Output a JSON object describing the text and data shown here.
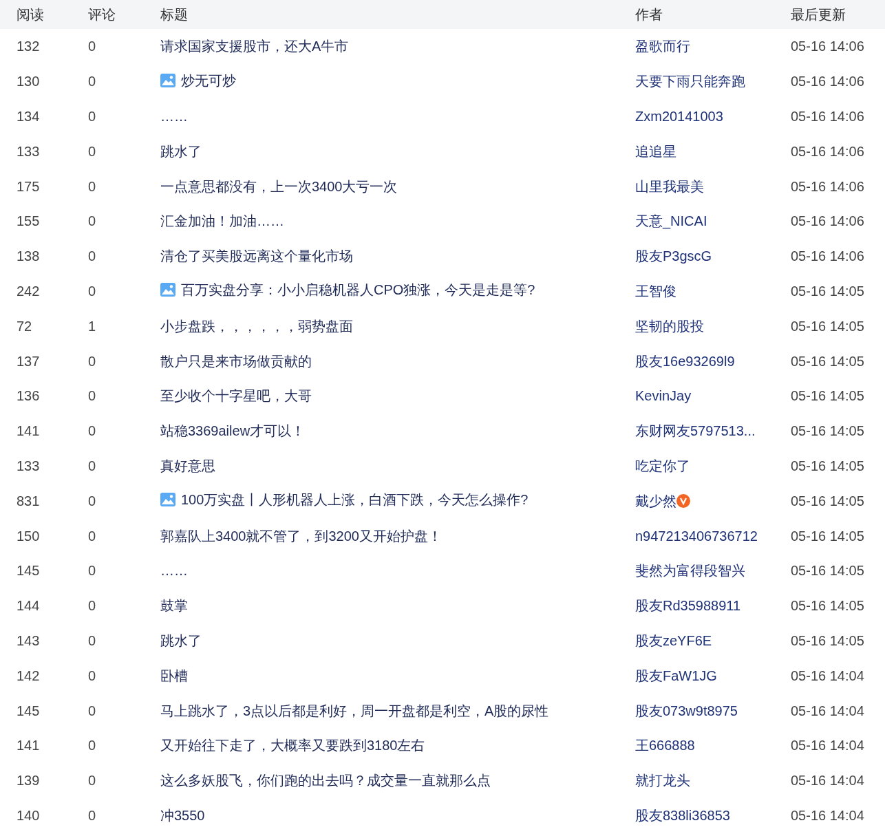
{
  "table": {
    "columns": [
      "阅读",
      "评论",
      "标题",
      "作者",
      "最后更新"
    ],
    "rows": [
      {
        "reads": "132",
        "comments": "0",
        "title": "请求国家支援股市，还大A牛市",
        "has_image": false,
        "author": "盈歌而行",
        "verified": false,
        "updated": "05-16 14:06"
      },
      {
        "reads": "130",
        "comments": "0",
        "title": "炒无可炒",
        "has_image": true,
        "author": "天要下雨只能奔跑",
        "verified": false,
        "updated": "05-16 14:06"
      },
      {
        "reads": "134",
        "comments": "0",
        "title": "……",
        "has_image": false,
        "author": "Zxm20141003",
        "verified": false,
        "updated": "05-16 14:06"
      },
      {
        "reads": "133",
        "comments": "0",
        "title": "跳水了",
        "has_image": false,
        "author": "追追星",
        "verified": false,
        "updated": "05-16 14:06"
      },
      {
        "reads": "175",
        "comments": "0",
        "title": "一点意思都没有，上一次3400大亏一次",
        "has_image": false,
        "author": "山里我最美",
        "verified": false,
        "updated": "05-16 14:06"
      },
      {
        "reads": "155",
        "comments": "0",
        "title": "汇金加油！加油……",
        "has_image": false,
        "author": "天意_NICAI",
        "verified": false,
        "updated": "05-16 14:06"
      },
      {
        "reads": "138",
        "comments": "0",
        "title": "清仓了买美股远离这个量化市场",
        "has_image": false,
        "author": "股友P3gscG",
        "verified": false,
        "updated": "05-16 14:06"
      },
      {
        "reads": "242",
        "comments": "0",
        "title": "百万实盘分享：小小启稳机器人CPO独涨，今天是走是等?",
        "has_image": true,
        "author": "王智俊",
        "verified": false,
        "updated": "05-16 14:05"
      },
      {
        "reads": "72",
        "comments": "1",
        "title": "小步盘跌，，，，，，弱势盘面",
        "has_image": false,
        "author": "坚韧的股投",
        "verified": false,
        "updated": "05-16 14:05"
      },
      {
        "reads": "137",
        "comments": "0",
        "title": "散户只是来市场做贡献的",
        "has_image": false,
        "author": "股友16e93269l9",
        "verified": false,
        "updated": "05-16 14:05"
      },
      {
        "reads": "136",
        "comments": "0",
        "title": "至少收个十字星吧，大哥",
        "has_image": false,
        "author": "KevinJay",
        "verified": false,
        "updated": "05-16 14:05"
      },
      {
        "reads": "141",
        "comments": "0",
        "title": "站稳3369ailew才可以！",
        "has_image": false,
        "author": "东财网友5797513...",
        "verified": false,
        "updated": "05-16 14:05"
      },
      {
        "reads": "133",
        "comments": "0",
        "title": "真好意思",
        "has_image": false,
        "author": "吃定你了",
        "verified": false,
        "updated": "05-16 14:05"
      },
      {
        "reads": "831",
        "comments": "0",
        "title": "100万实盘丨人形机器人上涨，白酒下跌，今天怎么操作?",
        "has_image": true,
        "author": "戴少然",
        "verified": true,
        "updated": "05-16 14:05"
      },
      {
        "reads": "150",
        "comments": "0",
        "title": "郭嘉队上3400就不管了，到3200又开始护盘！",
        "has_image": false,
        "author": "n947213406736712",
        "verified": false,
        "updated": "05-16 14:05"
      },
      {
        "reads": "145",
        "comments": "0",
        "title": "……",
        "has_image": false,
        "author": "斐然为富得段智兴",
        "verified": false,
        "updated": "05-16 14:05"
      },
      {
        "reads": "144",
        "comments": "0",
        "title": "鼓掌",
        "has_image": false,
        "author": "股友Rd35988911",
        "verified": false,
        "updated": "05-16 14:05"
      },
      {
        "reads": "143",
        "comments": "0",
        "title": "跳水了",
        "has_image": false,
        "author": "股友zeYF6E",
        "verified": false,
        "updated": "05-16 14:05"
      },
      {
        "reads": "142",
        "comments": "0",
        "title": "卧槽",
        "has_image": false,
        "author": "股友FaW1JG",
        "verified": false,
        "updated": "05-16 14:04"
      },
      {
        "reads": "145",
        "comments": "0",
        "title": "马上跳水了，3点以后都是利好，周一开盘都是利空，A股的尿性",
        "has_image": false,
        "author": "股友073w9t8975",
        "verified": false,
        "updated": "05-16 14:04"
      },
      {
        "reads": "141",
        "comments": "0",
        "title": "又开始往下走了，大概率又要跌到3180左右",
        "has_image": false,
        "author": "王666888",
        "verified": false,
        "updated": "05-16 14:04"
      },
      {
        "reads": "139",
        "comments": "0",
        "title": "这么多妖股飞，你们跑的出去吗？成交量一直就那么点",
        "has_image": false,
        "author": "就打龙头",
        "verified": false,
        "updated": "05-16 14:04"
      },
      {
        "reads": "140",
        "comments": "0",
        "title": "冲3550",
        "has_image": false,
        "author": "股友838li36853",
        "verified": false,
        "updated": "05-16 14:04"
      }
    ]
  }
}
